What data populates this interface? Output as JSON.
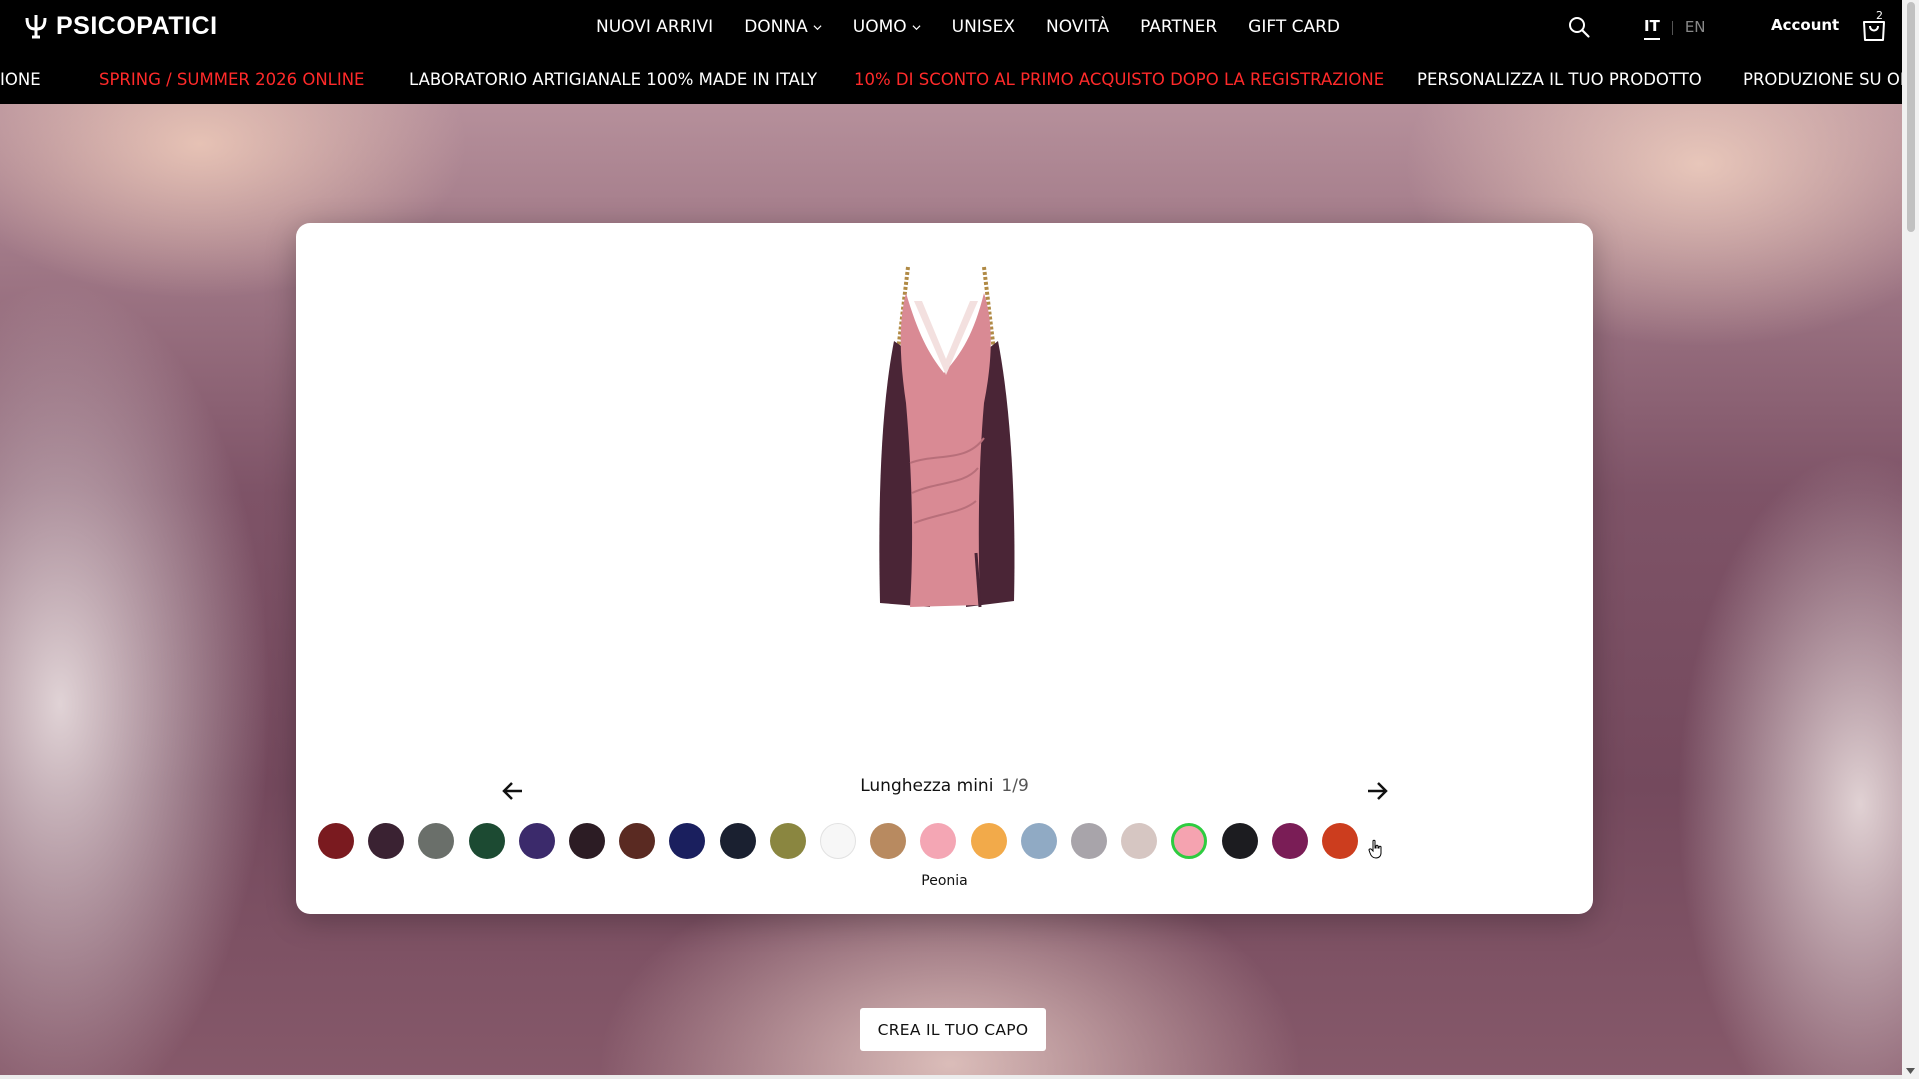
{
  "brand": {
    "name": "PSICOPATICI"
  },
  "nav": {
    "items": [
      {
        "label": "NUOVI ARRIVI",
        "dropdown": false
      },
      {
        "label": "DONNA",
        "dropdown": true
      },
      {
        "label": "UOMO",
        "dropdown": true
      },
      {
        "label": "UNISEX",
        "dropdown": false
      },
      {
        "label": "NOVITÀ",
        "dropdown": false
      },
      {
        "label": "PARTNER",
        "dropdown": false
      },
      {
        "label": "GIFT CARD",
        "dropdown": false
      }
    ]
  },
  "header": {
    "lang_it": "IT",
    "lang_en": "EN",
    "account": "Account",
    "cart_count": "2",
    "icons": {
      "search": "search-icon",
      "cart": "shopping-bag-icon"
    }
  },
  "ticker": {
    "items": [
      {
        "text": "IONE",
        "highlight": false
      },
      {
        "text": "SPRING / SUMMER 2026 ONLINE",
        "highlight": true
      },
      {
        "text": "LABORATORIO ARTIGIANALE 100% MADE IN ITALY",
        "highlight": false
      },
      {
        "text": "10% DI SCONTO AL PRIMO ACQUISTO DOPO LA REGISTRAZIONE",
        "highlight": true
      },
      {
        "text": "PERSONALIZZA IL TUO PRODOTTO",
        "highlight": false
      },
      {
        "text": "PRODUZIONE SU ORD",
        "highlight": false
      }
    ]
  },
  "configurator": {
    "option_label": "Lunghezza mini",
    "option_count": "1/9",
    "selected_color_name": "Peonia",
    "swatches": [
      "#7a1a1f",
      "#3a2232",
      "#6a6f6a",
      "#1c4a32",
      "#3b2a6b",
      "#2c1c24",
      "#5a2a22",
      "#1a1f5e",
      "#1a2030",
      "#8a8640",
      "#f7f7f7",
      "#b88a60",
      "#f4a6b4",
      "#f2aa4a",
      "#90aac4",
      "#a8a4aa",
      "#d6c6c2",
      "#f5a3b0",
      "#1c1c20",
      "#7a1d56",
      "#cc3d1e"
    ],
    "selected_index": 17
  },
  "cta": {
    "label": "CREA IL TUO CAPO"
  },
  "colors": {
    "accent_red": "#ff2a2a",
    "selected_ring": "#2ecc40"
  }
}
